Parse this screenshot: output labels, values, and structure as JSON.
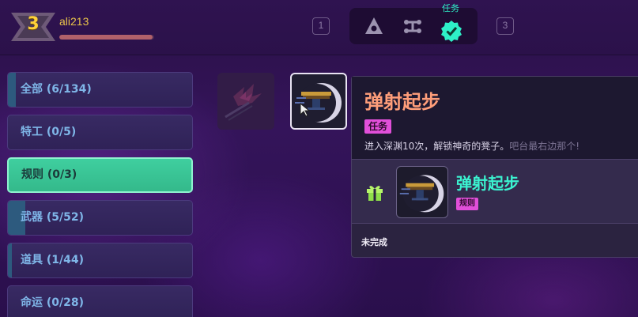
{
  "player": {
    "level": "3",
    "name": "ali213",
    "xp_fraction": 0.98
  },
  "tabs": {
    "left_key": "1",
    "right_key": "3",
    "active_label": "任务",
    "items": [
      {
        "icon": "tower-icon",
        "active": false
      },
      {
        "icon": "nodes-icon",
        "active": false
      },
      {
        "icon": "check-badge-icon",
        "active": true
      }
    ]
  },
  "categories": [
    {
      "label": "全部 (6/134)",
      "progress": 0.045,
      "active": false
    },
    {
      "label": "特工 (0/5)",
      "progress": 0,
      "active": false
    },
    {
      "label": "规则 (0/3)",
      "progress": 0,
      "active": true
    },
    {
      "label": "武器 (5/52)",
      "progress": 0.096,
      "active": false
    },
    {
      "label": "道具 (1/44)",
      "progress": 0.023,
      "active": false
    },
    {
      "label": "命运 (0/28)",
      "progress": 0,
      "active": false
    }
  ],
  "detail": {
    "title": "弹射起步",
    "tag": "任务",
    "description": "进入深渊10次，解锁神奇的凳子。",
    "hint": "吧台最右边那个!",
    "reward": {
      "title": "弹射起步",
      "tag": "规则"
    },
    "status": "未完成"
  },
  "colors": {
    "accent": "#3bf3d0",
    "tag": "#e14fd9",
    "title": "#ff9e7a",
    "active_category": "#3fcf9f"
  }
}
